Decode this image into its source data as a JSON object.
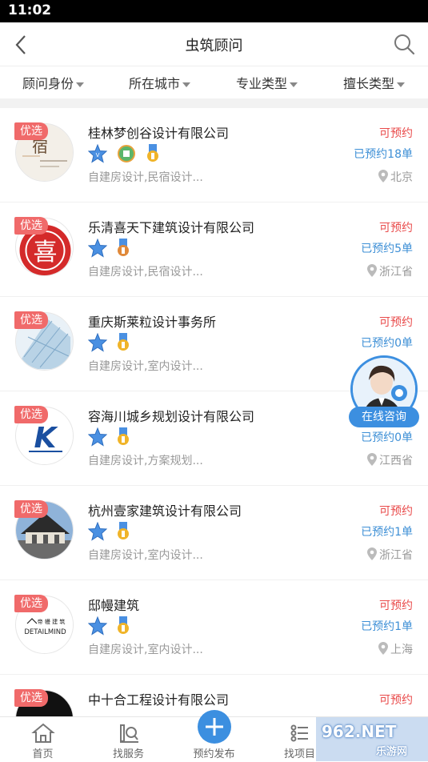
{
  "status_bar": {
    "time": "11:02"
  },
  "header": {
    "title": "虫筑顾问"
  },
  "filters": [
    {
      "label": "顾问身份"
    },
    {
      "label": "所在城市"
    },
    {
      "label": "专业类型"
    },
    {
      "label": "擅长类型"
    }
  ],
  "tag_label": "优选",
  "advisors": [
    {
      "name": "桂林梦创谷设计有限公司",
      "desc": "自建房设计,民宿设计...",
      "status": "可预约",
      "booked": "已预约18单",
      "location": "北京",
      "badge_count": 3
    },
    {
      "name": "乐清喜天下建筑设计有限公司",
      "desc": "自建房设计,民宿设计...",
      "status": "可预约",
      "booked": "已预约5单",
      "location": "浙江省",
      "badge_count": 2
    },
    {
      "name": "重庆斯莱粒设计事务所",
      "desc": "自建房设计,室内设计...",
      "status": "可预约",
      "booked": "已预约0单",
      "location": "",
      "badge_count": 2
    },
    {
      "name": "容海川城乡规划设计有限公司",
      "desc": "自建房设计,方案规划...",
      "status": "",
      "booked": "已预约0单",
      "location": "江西省",
      "badge_count": 2
    },
    {
      "name": "杭州壹家建筑设计有限公司",
      "desc": "自建房设计,室内设计...",
      "status": "可预约",
      "booked": "已预约1单",
      "location": "浙江省",
      "badge_count": 2
    },
    {
      "name": "邸幔建筑",
      "desc": "自建房设计,室内设计...",
      "status": "可预约",
      "booked": "已预约1单",
      "location": "上海",
      "badge_count": 2
    },
    {
      "name": "中十合工程设计有限公司",
      "desc": "",
      "status": "可预约",
      "booked": "",
      "location": "",
      "badge_count": 0
    }
  ],
  "avatar_texts": {
    "a0": "宿",
    "a1": "喜",
    "a3": "K",
    "a5": "DETAILMIND",
    "a5b": "帝 幔 建 筑"
  },
  "float_button": {
    "label": "在线咨询"
  },
  "tabs": [
    {
      "label": "首页"
    },
    {
      "label": "找服务"
    },
    {
      "label": "预约发布"
    },
    {
      "label": "找项目"
    }
  ],
  "watermark": {
    "text": "962.NET",
    "sub": "乐游网"
  },
  "colors": {
    "accent": "#3c8fe0",
    "tag": "#f06a6a",
    "status": "#e94b4b",
    "booked": "#3d8fd6"
  }
}
